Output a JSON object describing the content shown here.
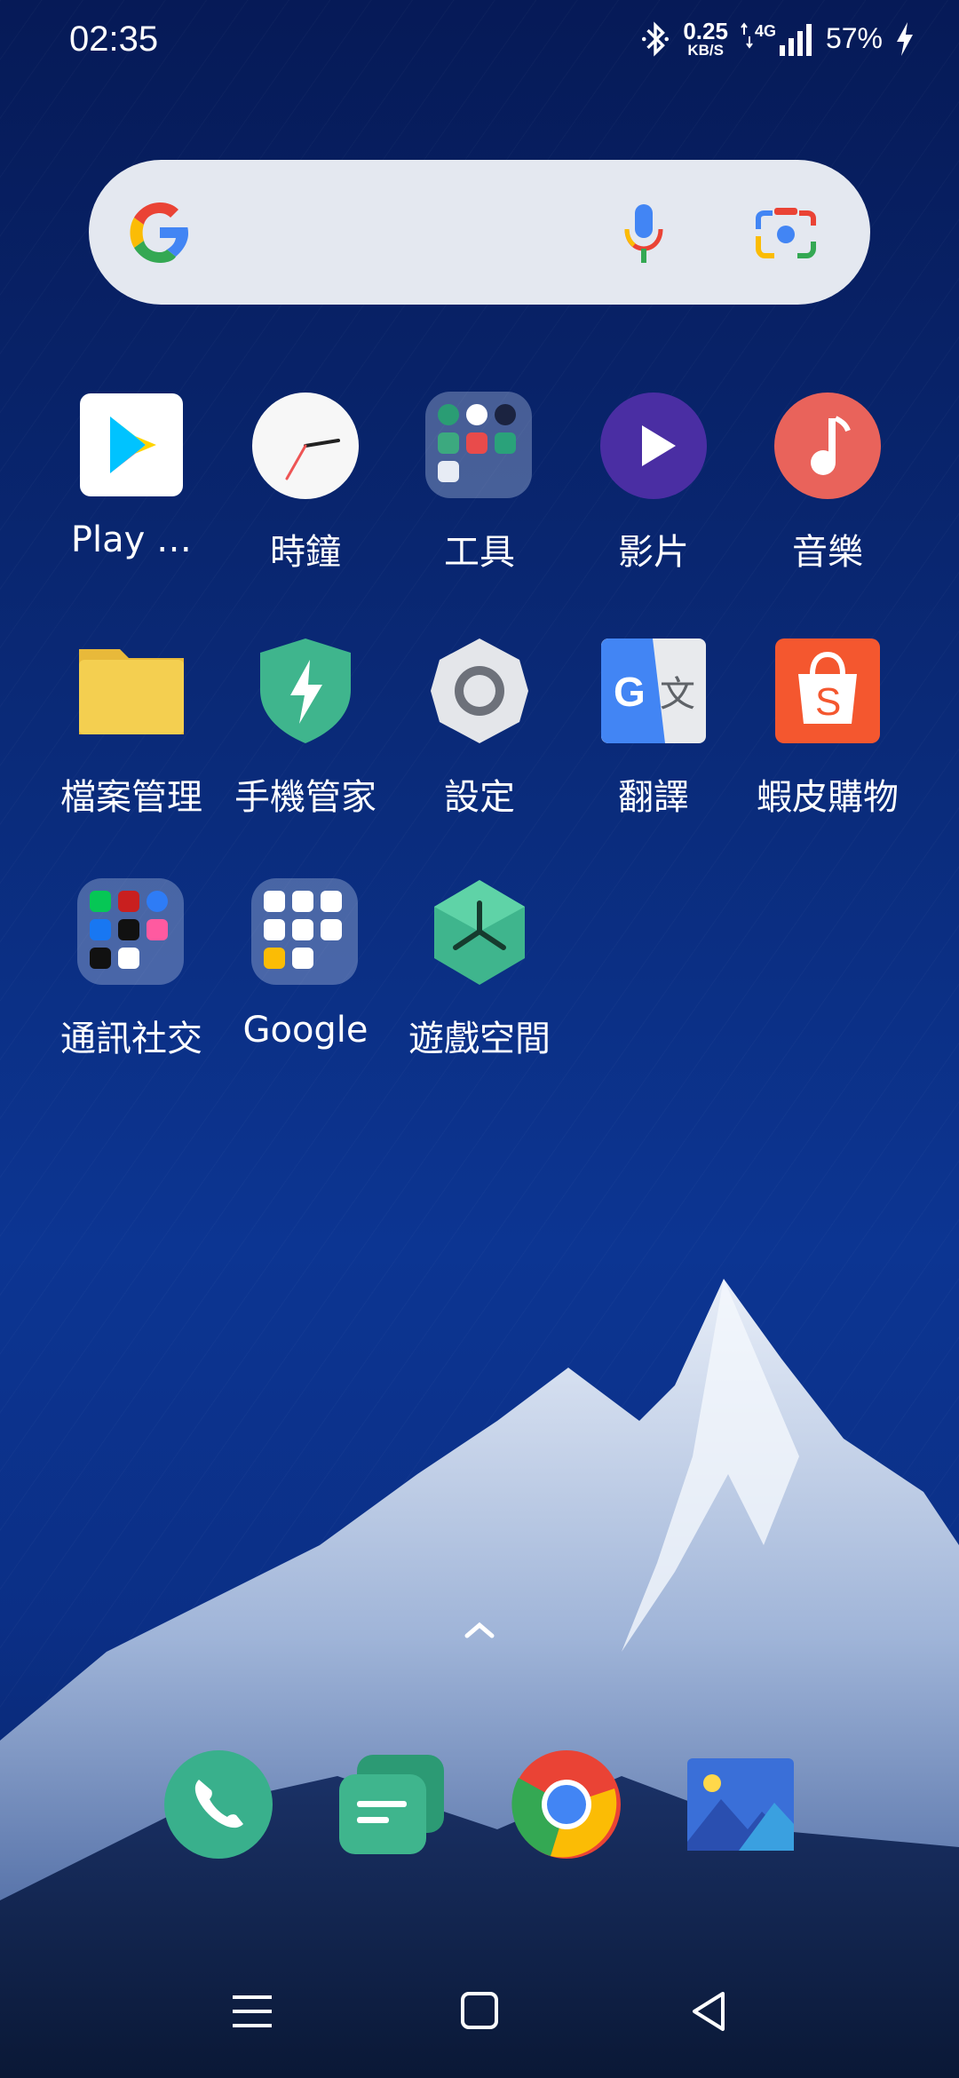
{
  "status_bar": {
    "time": "02:35",
    "net_speed_value": "0.25",
    "net_speed_unit": "KB/S",
    "network_type": "4G",
    "battery": "57%",
    "icons": [
      "bluetooth-icon",
      "data-arrows-icon",
      "signal-icon",
      "charging-icon"
    ]
  },
  "search_bar": {
    "icons": [
      "google-logo-icon",
      "mic-icon",
      "lens-camera-icon"
    ]
  },
  "apps": [
    {
      "label": "Play …",
      "icon": "play-store-icon"
    },
    {
      "label": "時鐘",
      "icon": "clock-icon"
    },
    {
      "label": "工具",
      "icon": "tools-folder-icon"
    },
    {
      "label": "影片",
      "icon": "video-icon"
    },
    {
      "label": "音樂",
      "icon": "music-icon"
    },
    {
      "label": "檔案管理",
      "icon": "file-manager-icon"
    },
    {
      "label": "手機管家",
      "icon": "phone-manager-icon"
    },
    {
      "label": "設定",
      "icon": "settings-gear-icon"
    },
    {
      "label": "翻譯",
      "icon": "translate-icon"
    },
    {
      "label": "蝦皮購物",
      "icon": "shopee-icon"
    },
    {
      "label": "通訊社交",
      "icon": "social-folder-icon"
    },
    {
      "label": "Google",
      "icon": "google-folder-icon"
    },
    {
      "label": "遊戲空間",
      "icon": "game-space-icon"
    }
  ],
  "dock": [
    "phone-icon",
    "messages-icon",
    "chrome-icon",
    "gallery-icon"
  ],
  "nav_bar": [
    "menu-icon",
    "home-icon",
    "back-icon"
  ],
  "colors": {
    "video": "#4a2ea3",
    "music": "#e9635b",
    "shopee": "#f4572f",
    "manager": "#3fb58d",
    "gamespace": "#3fb58d"
  }
}
